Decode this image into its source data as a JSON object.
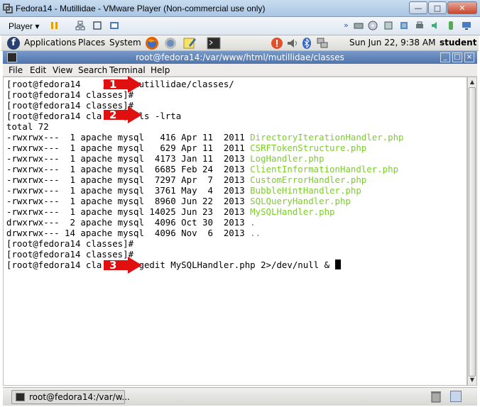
{
  "vm_window": {
    "title": "Fedora14 - Mutillidae - VMware Player (Non-commercial use only)",
    "player_label": "Player",
    "buttons": {
      "minimize": "—",
      "maximize": "□",
      "close": "✕"
    }
  },
  "gnome_panel": {
    "menus": [
      "Applications",
      "Places",
      "System"
    ],
    "clock": "Sun Jun 22,  9:38 AM",
    "user": "student"
  },
  "terminal": {
    "title": "root@fedora14:/var/www/html/mutillidae/classes",
    "menu": [
      "File",
      "Edit",
      "View",
      "Search",
      "Terminal",
      "Help"
    ],
    "lines": [
      {
        "text": "[root@fedora14    ]# cd mutillidae/classes/"
      },
      {
        "text": "[root@fedora14 classes]#"
      },
      {
        "text": "[root@fedora14 classes]#"
      },
      {
        "text": "[root@fedora14 cla    ]# ls -lrta"
      },
      {
        "text": "total 72"
      },
      {
        "perm": "-rwxrwx---  1 apache mysql   416 Apr 11  2011 ",
        "file": "DirectoryIterationHandler.php",
        "cls": "green"
      },
      {
        "perm": "-rwxrwx---  1 apache mysql   629 Apr 11  2011 ",
        "file": "CSRFTokenStructure.php",
        "cls": "green"
      },
      {
        "perm": "-rwxrwx---  1 apache mysql  4173 Jan 11  2013 ",
        "file": "LogHandler.php",
        "cls": "green"
      },
      {
        "perm": "-rwxrwx---  1 apache mysql  6685 Feb 24  2013 ",
        "file": "ClientInformationHandler.php",
        "cls": "green"
      },
      {
        "perm": "-rwxrwx---  1 apache mysql  7297 Apr  7  2013 ",
        "file": "CustomErrorHandler.php",
        "cls": "green"
      },
      {
        "perm": "-rwxrwx---  1 apache mysql  3761 May  4  2013 ",
        "file": "BubbleHintHandler.php",
        "cls": "green"
      },
      {
        "perm": "-rwxrwx---  1 apache mysql  8960 Jun 22  2013 ",
        "file": "SQLQueryHandler.php",
        "cls": "green"
      },
      {
        "perm": "-rwxrwx---  1 apache mysql 14025 Jun 23  2013 ",
        "file": "MySQLHandler.php",
        "cls": "green"
      },
      {
        "perm": "drwxrwx---  2 apache mysql  4096 Oct 30  2013 ",
        "file": ".",
        "cls": "blue"
      },
      {
        "perm": "drwxrwx--- 14 apache mysql  4096 Nov  6  2013 ",
        "file": "..",
        "cls": "blue"
      },
      {
        "text": "[root@fedora14 classes]#"
      },
      {
        "text": "[root@fedora14 classes]#"
      },
      {
        "text": "[root@fedora14 cla    ]# gedit MySQLHandler.php 2>/dev/null & ",
        "cursor": true
      }
    ]
  },
  "annotations": [
    "1",
    "2",
    "3"
  ],
  "taskbar": {
    "task_label": "root@fedora14:/var/w..."
  }
}
